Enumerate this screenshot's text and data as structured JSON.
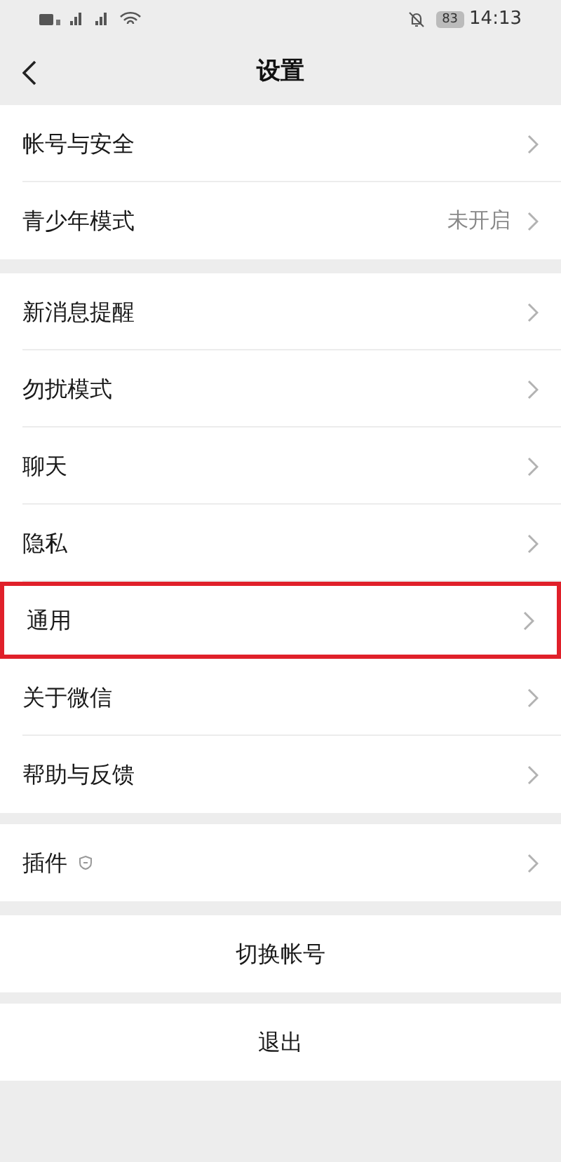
{
  "status_bar": {
    "battery": "83",
    "time": "14:13"
  },
  "nav": {
    "title": "设置"
  },
  "groups": [
    {
      "rows": [
        {
          "label": "帐号与安全",
          "highlighted": false
        },
        {
          "label": "青少年模式",
          "value": "未开启",
          "highlighted": false
        }
      ]
    },
    {
      "rows": [
        {
          "label": "新消息提醒",
          "highlighted": false
        },
        {
          "label": "勿扰模式",
          "highlighted": false
        },
        {
          "label": "聊天",
          "highlighted": false
        },
        {
          "label": "隐私",
          "highlighted": false
        },
        {
          "label": "通用",
          "highlighted": true
        },
        {
          "label": "关于微信",
          "highlighted": false
        },
        {
          "label": "帮助与反馈",
          "highlighted": false
        }
      ]
    },
    {
      "rows": [
        {
          "label": "插件",
          "badge_icon": true,
          "highlighted": false
        }
      ]
    }
  ],
  "actions": [
    {
      "label": "切换帐号"
    },
    {
      "label": "退出"
    }
  ]
}
